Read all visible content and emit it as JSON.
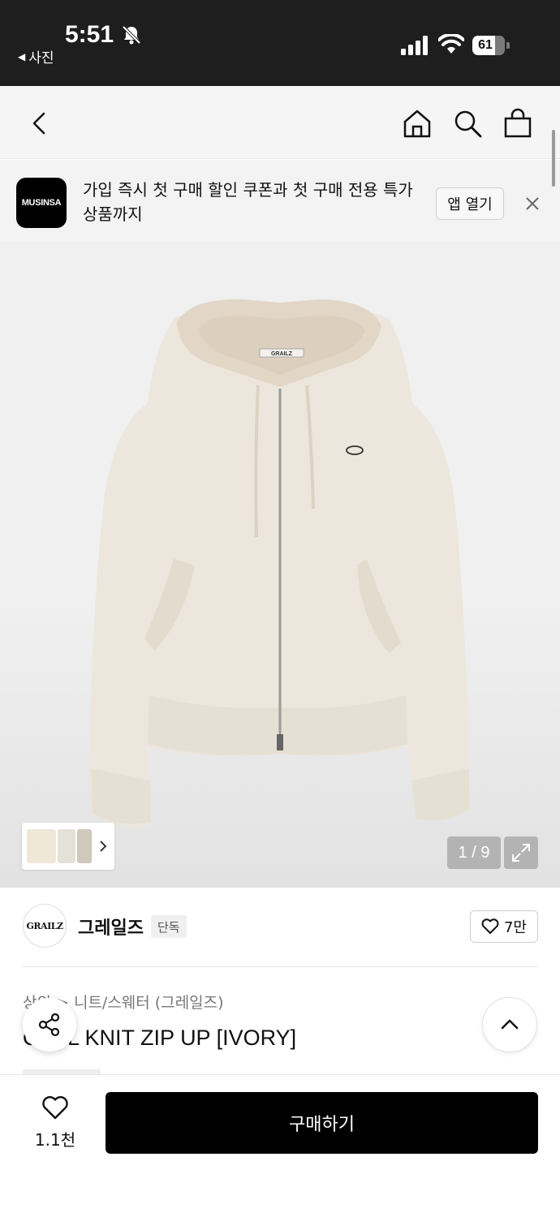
{
  "status_bar": {
    "time": "5:51",
    "back_app_label": "사진",
    "battery_level": "61",
    "icons": [
      "bell-slash-icon",
      "signal-icon",
      "wifi-icon",
      "battery-icon"
    ]
  },
  "nav": {
    "icons": [
      "back-arrow-icon",
      "home-icon",
      "search-icon",
      "shopping-bag-icon"
    ]
  },
  "banner": {
    "logo_text": "MUSINSA",
    "message": "가입 즉시 첫 구매 할인 쿠폰과 첫 구매 전용 특가 상품까지",
    "open_app_label": "앱 열기"
  },
  "gallery": {
    "counter": "1 / 9",
    "current_index": 1,
    "total": 9,
    "product_color": "#ece6dc",
    "hood_color": "#e2d6c6",
    "logo_text": "GRAILZ"
  },
  "brand": {
    "logo_text": "GRAILZ",
    "name": "그레일즈",
    "badge": "단독",
    "like_count": "7만"
  },
  "product": {
    "category": "상의 > 니트/스웨터 (그레일즈)",
    "name": "OVAL KNIT ZIP UP [IVORY]"
  },
  "bottom_bar": {
    "wish_count": "1.1천",
    "buy_label": "구매하기"
  }
}
